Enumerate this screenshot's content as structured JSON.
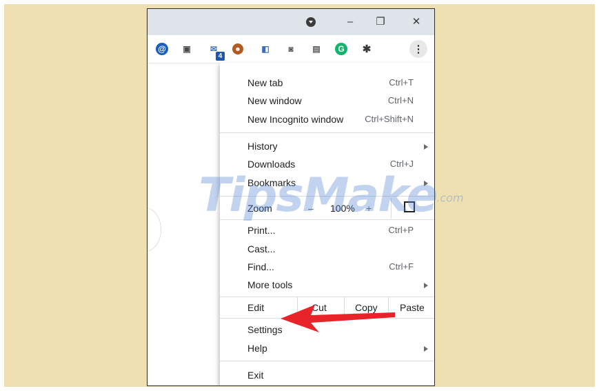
{
  "window": {
    "controls": {
      "minimize": "–",
      "restore": "❐",
      "close": "✕"
    }
  },
  "toolbar": {
    "extensions": [
      {
        "name": "account-icon",
        "glyph": "@"
      },
      {
        "name": "save-icon",
        "glyph": "▣"
      },
      {
        "name": "mail-extension-icon",
        "glyph": "✉"
      },
      {
        "name": "avatar-extension-icon",
        "glyph": "☻"
      },
      {
        "name": "reader-icon",
        "glyph": "◧"
      },
      {
        "name": "camera-icon",
        "glyph": "◙"
      },
      {
        "name": "gallery-icon",
        "glyph": "▤"
      },
      {
        "name": "grammarly-icon",
        "glyph": "G"
      },
      {
        "name": "puzzle-icon",
        "glyph": "✱"
      }
    ],
    "badge": "4",
    "menu_glyph": "⋮"
  },
  "menu": {
    "new_tab": {
      "label": "New tab",
      "shortcut": "Ctrl+T"
    },
    "new_window": {
      "label": "New window",
      "shortcut": "Ctrl+N"
    },
    "new_incognito": {
      "label": "New Incognito window",
      "shortcut": "Ctrl+Shift+N"
    },
    "history": {
      "label": "History"
    },
    "downloads": {
      "label": "Downloads",
      "shortcut": "Ctrl+J"
    },
    "bookmarks": {
      "label": "Bookmarks"
    },
    "zoom": {
      "label": "Zoom",
      "minus": "–",
      "value": "100%",
      "plus": "+"
    },
    "print": {
      "label": "Print...",
      "shortcut": "Ctrl+P"
    },
    "cast": {
      "label": "Cast..."
    },
    "find": {
      "label": "Find...",
      "shortcut": "Ctrl+F"
    },
    "more_tools": {
      "label": "More tools"
    },
    "edit": {
      "label": "Edit",
      "cut": "Cut",
      "copy": "Copy",
      "paste": "Paste"
    },
    "settings": {
      "label": "Settings"
    },
    "help": {
      "label": "Help"
    },
    "exit": {
      "label": "Exit"
    }
  },
  "watermark": {
    "main": "TipsMake",
    "suffix": ".com"
  },
  "colors": {
    "background": "#efe0b2",
    "arrow": "#e8232a",
    "titlebar": "#dfe3ea"
  }
}
